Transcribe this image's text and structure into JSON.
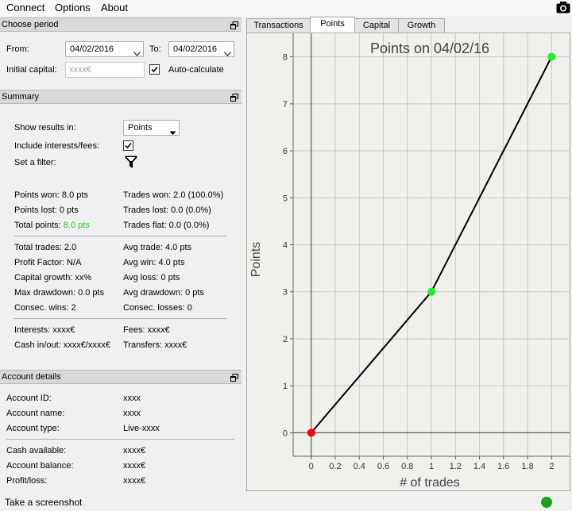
{
  "menu": {
    "connect": "Connect",
    "options": "Options",
    "about": "About"
  },
  "period": {
    "title": "Choose period",
    "from_label": "From:",
    "from_value": "04/02/2016",
    "to_label": "To:",
    "to_value": "04/02/2016",
    "capital_label": "Initial capital:",
    "capital_placeholder": "xxxx€",
    "auto_calc_label": "Auto-calculate",
    "auto_calc_checked": true
  },
  "summary": {
    "title": "Summary",
    "show_results_label": "Show results in:",
    "show_results_value": "Points",
    "include_label": "Include interests/fees:",
    "include_checked": true,
    "filter_label": "Set a filter:",
    "points_won": "Points won: 8.0 pts",
    "points_lost": "Points lost: 0 pts",
    "total_points_label": "Total points:",
    "total_points_value": "8.0 pts",
    "trades_won": "Trades won: 2.0 (100.0%)",
    "trades_lost": "Trades lost: 0.0 (0.0%)",
    "trades_flat": "Trades flat: 0.0 (0.0%)",
    "total_trades": "Total trades: 2.0",
    "profit_factor": "Profit Factor: N/A",
    "capital_growth": "Capital growth: xx%",
    "max_drawdown": "Max drawdown: 0.0 pts",
    "consec_wins": "Consec. wins: 2",
    "avg_trade": "Avg trade: 4.0 pts",
    "avg_win": "Avg win: 4.0 pts",
    "avg_loss": "Avg loss: 0 pts",
    "avg_drawdown": "Avg drawdown: 0 pts",
    "consec_losses": "Consec. losses: 0",
    "interests": "Interests: xxxx€",
    "cash_inout": "Cash in/out: xxxx€/xxxx€",
    "fees": "Fees: xxxx€",
    "transfers": "Transfers: xxxx€"
  },
  "account": {
    "title": "Account details",
    "id_label": "Account ID:",
    "id_value": "xxxx",
    "name_label": "Account name:",
    "name_value": "xxxx",
    "type_label": "Account type:",
    "type_value": "Live-xxxx",
    "cash_label": "Cash available:",
    "cash_value": "xxxx€",
    "balance_label": "Account balance:",
    "balance_value": "xxxx€",
    "pl_label": "Profit/loss:",
    "pl_value": "xxxx€"
  },
  "tabs": [
    {
      "label": "Transactions",
      "active": false
    },
    {
      "label": "Points",
      "active": true
    },
    {
      "label": "Capital",
      "active": false
    },
    {
      "label": "Growth",
      "active": false
    }
  ],
  "status": {
    "text": "Take a screenshot",
    "indicator_color": "#1ea11e"
  },
  "chart_data": {
    "type": "line",
    "title": "Points on 04/02/16",
    "xlabel": "# of trades",
    "ylabel": "Points",
    "xlim": [
      -0.15,
      2.15
    ],
    "ylim": [
      -0.5,
      8.5
    ],
    "x_ticks": [
      "0",
      "0.2",
      "0.4",
      "0.6",
      "0.8",
      "1",
      "1.2",
      "1.4",
      "1.6",
      "1.8",
      "2"
    ],
    "x_tick_values": [
      0,
      0.2,
      0.4,
      0.6,
      0.8,
      1,
      1.2,
      1.4,
      1.6,
      1.8,
      2
    ],
    "y_ticks": [
      "0",
      "1",
      "2",
      "3",
      "4",
      "5",
      "6",
      "7",
      "8"
    ],
    "y_tick_values": [
      0,
      1,
      2,
      3,
      4,
      5,
      6,
      7,
      8
    ],
    "grid": true,
    "line_color": "#000000",
    "series": [
      {
        "x": [
          0,
          1,
          2
        ],
        "y": [
          0,
          3,
          8
        ]
      }
    ],
    "point_colors": [
      "#ff0000",
      "#22ee22",
      "#22ee22"
    ]
  }
}
